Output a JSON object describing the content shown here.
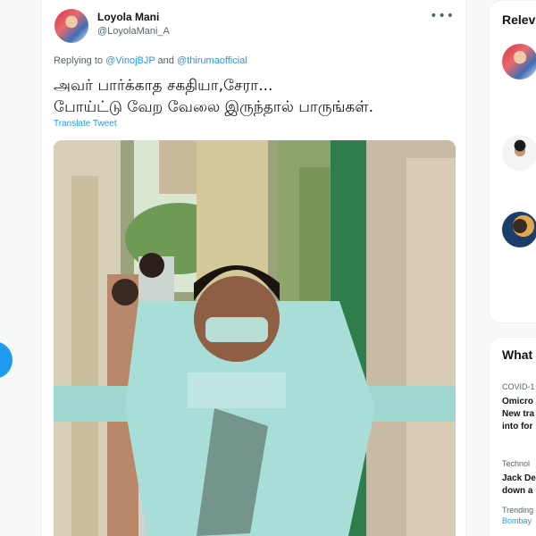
{
  "tweet": {
    "author_name": "Loyola Mani",
    "author_handle": "@LoyolaMani_A",
    "more_icon": "more-horizontal-icon",
    "replying_prefix": "Replying to ",
    "mention_1": "@VinojBJP",
    "replying_joiner": " and ",
    "mention_2": "@thirumaofficial",
    "text_line_1": "அவர் பார்க்காத சகதியா,சேரா...",
    "text_line_2": "போய்ட்டு வேற வேலை இருந்தால் பாருங்கள்.",
    "translate_label": "Translate Tweet"
  },
  "sidebar": {
    "relevant_title": "Relev",
    "whats_title": "What",
    "trends": [
      {
        "meta": "COVID-1",
        "line_1": "Omicro",
        "line_2": "New tra",
        "line_3": "into for"
      },
      {
        "meta": "Technol",
        "line_1": "Jack De",
        "line_2": "down a"
      },
      {
        "meta": "Trending",
        "link": "Bombay"
      }
    ]
  },
  "colors": {
    "accent": "#1d9bf0",
    "text": "#0f1419",
    "muted": "#536471",
    "background": "#f7f9f9"
  }
}
